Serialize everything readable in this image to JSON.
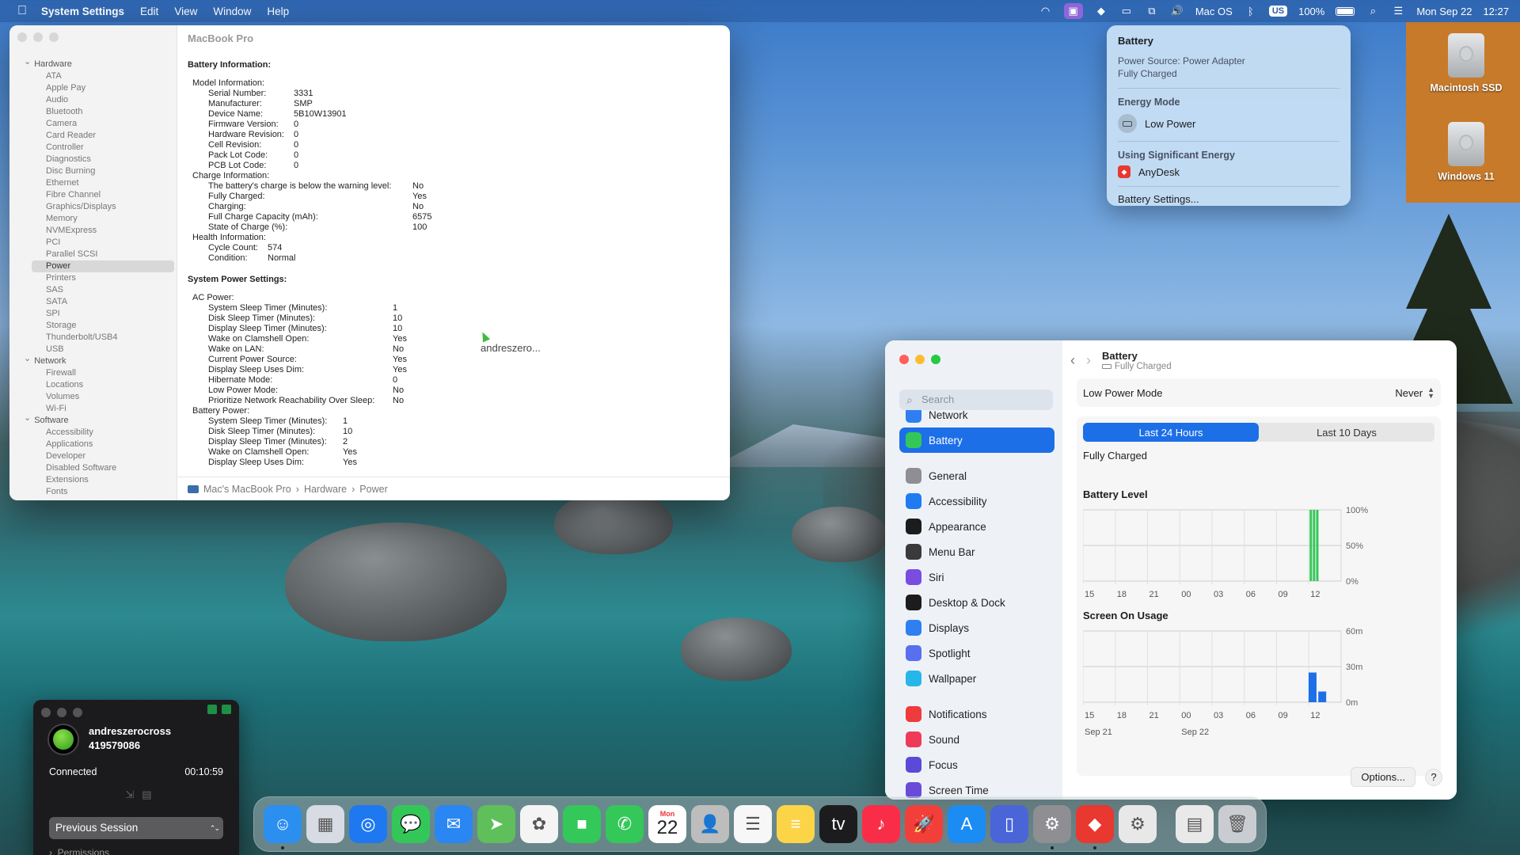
{
  "menubar": {
    "app_name": "System Settings",
    "menus": [
      "Edit",
      "View",
      "Window",
      "Help"
    ],
    "keyboard_layout": "Mac OS",
    "input_badge": "US",
    "battery_percent": "100%",
    "date": "Mon Sep 22",
    "time": "12:27",
    "icons": [
      "wifi-icon",
      "screen-share-icon",
      "anydesk-icon",
      "display-icon",
      "screen-mirroring-icon",
      "volume-icon",
      "bluetooth-icon",
      "battery-icon",
      "spotlight-icon",
      "control-center-icon"
    ]
  },
  "battery_menu": {
    "title": "Battery",
    "power_source": "Power Source: Power Adapter",
    "state": "Fully Charged",
    "energy_mode_title": "Energy Mode",
    "low_power": "Low Power",
    "significant_title": "Using Significant Energy",
    "app": "AnyDesk",
    "settings_link": "Battery Settings..."
  },
  "desktop_icons": [
    {
      "label": "Macintosh SSD"
    },
    {
      "label": "Windows 11"
    }
  ],
  "system_info": {
    "title": "MacBook Pro",
    "tree": [
      {
        "group": "Hardware",
        "items": [
          "ATA",
          "Apple Pay",
          "Audio",
          "Bluetooth",
          "Camera",
          "Card Reader",
          "Controller",
          "Diagnostics",
          "Disc Burning",
          "Ethernet",
          "Fibre Channel",
          "Graphics/Displays",
          "Memory",
          "NVMExpress",
          "PCI",
          "Parallel SCSI",
          "Power",
          "Printers",
          "SAS",
          "SATA",
          "SPI",
          "Storage",
          "Thunderbolt/USB4",
          "USB"
        ]
      },
      {
        "group": "Network",
        "items": [
          "Firewall",
          "Locations",
          "Volumes",
          "Wi-Fi"
        ]
      },
      {
        "group": "Software",
        "items": [
          "Accessibility",
          "Applications",
          "Developer",
          "Disabled Software",
          "Extensions",
          "Fonts"
        ]
      }
    ],
    "selected": "Power",
    "battery_info_heading": "Battery Information:",
    "model_info_heading": "Model Information:",
    "model_info": [
      [
        "Serial Number:",
        "3331"
      ],
      [
        "Manufacturer:",
        "SMP"
      ],
      [
        "Device Name:",
        "5B10W13901"
      ],
      [
        "Firmware Version:",
        "0"
      ],
      [
        "Hardware Revision:",
        "0"
      ],
      [
        "Cell Revision:",
        "0"
      ],
      [
        "Pack Lot Code:",
        "0"
      ],
      [
        "PCB Lot Code:",
        "0"
      ]
    ],
    "charge_info_heading": "Charge Information:",
    "charge_info": [
      [
        "The battery's charge is below the warning level:",
        "No"
      ],
      [
        "Fully Charged:",
        "Yes"
      ],
      [
        "Charging:",
        "No"
      ],
      [
        "Full Charge Capacity (mAh):",
        "6575"
      ],
      [
        "State of Charge (%):",
        "100"
      ]
    ],
    "health_info_heading": "Health Information:",
    "health_info": [
      [
        "Cycle Count:",
        "574"
      ],
      [
        "Condition:",
        "Normal"
      ]
    ],
    "power_settings_heading": "System Power Settings:",
    "ac_power_heading": "AC Power:",
    "ac_power": [
      [
        "System Sleep Timer (Minutes):",
        "1"
      ],
      [
        "Disk Sleep Timer (Minutes):",
        "10"
      ],
      [
        "Display Sleep Timer (Minutes):",
        "10"
      ],
      [
        "Wake on Clamshell Open:",
        "Yes"
      ],
      [
        "Wake on LAN:",
        "No"
      ],
      [
        "Current Power Source:",
        "Yes"
      ],
      [
        "Display Sleep Uses Dim:",
        "Yes"
      ],
      [
        "Hibernate Mode:",
        "0"
      ],
      [
        "Low Power Mode:",
        "No"
      ],
      [
        "Prioritize Network Reachability Over Sleep:",
        "No"
      ]
    ],
    "battery_power_heading": "Battery Power:",
    "battery_power": [
      [
        "System Sleep Timer (Minutes):",
        "1"
      ],
      [
        "Disk Sleep Timer (Minutes):",
        "10"
      ],
      [
        "Display Sleep Timer (Minutes):",
        "2"
      ],
      [
        "Wake on Clamshell Open:",
        "Yes"
      ],
      [
        "Display Sleep Uses Dim:",
        "Yes"
      ]
    ],
    "cursor_label": "andreszero...",
    "breadcrumb": [
      "Mac's MacBook Pro",
      "Hardware",
      "Power"
    ]
  },
  "settings": {
    "search_placeholder": "Search",
    "sidebar": [
      {
        "label": "Network",
        "color": "#2f7ff0",
        "icon": "globe-icon"
      },
      {
        "label": "Battery",
        "color": "#33c759",
        "icon": "battery-icon",
        "selected": true
      },
      {
        "gap": true
      },
      {
        "label": "General",
        "color": "#8e8e93",
        "icon": "gear-icon"
      },
      {
        "label": "Accessibility",
        "color": "#1f7bf2",
        "icon": "accessibility-icon"
      },
      {
        "label": "Appearance",
        "color": "#1c1c1e",
        "icon": "appearance-icon"
      },
      {
        "label": "Menu Bar",
        "color": "#3a3a3c",
        "icon": "menubar-icon"
      },
      {
        "label": "Siri",
        "color": "#7a4de0",
        "icon": "siri-icon"
      },
      {
        "label": "Desktop & Dock",
        "color": "#1c1c1e",
        "icon": "dock-icon"
      },
      {
        "label": "Displays",
        "color": "#2f7ff0",
        "icon": "displays-icon"
      },
      {
        "label": "Spotlight",
        "color": "#5a6ef0",
        "icon": "spotlight-icon"
      },
      {
        "label": "Wallpaper",
        "color": "#27b6e9",
        "icon": "wallpaper-icon"
      },
      {
        "gap": true
      },
      {
        "label": "Notifications",
        "color": "#ef3b3b",
        "icon": "notifications-icon"
      },
      {
        "label": "Sound",
        "color": "#ef3b5a",
        "icon": "sound-icon"
      },
      {
        "label": "Focus",
        "color": "#5b4ad8",
        "icon": "focus-icon"
      },
      {
        "label": "Screen Time",
        "color": "#6a4bd8",
        "icon": "screentime-icon"
      }
    ],
    "header_title": "Battery",
    "header_sub": "Fully Charged",
    "low_power_label": "Low Power Mode",
    "low_power_value": "Never",
    "tabs": [
      "Last 24 Hours",
      "Last 10 Days"
    ],
    "active_tab": 0,
    "status": "Fully Charged",
    "options_button": "Options...",
    "help_button": "?"
  },
  "chart_data": [
    {
      "type": "bar",
      "title": "Battery Level",
      "x_ticks": [
        "15",
        "18",
        "21",
        "00",
        "03",
        "06",
        "09",
        "12"
      ],
      "y_ticks": [
        "100%",
        "50%",
        "0%"
      ],
      "ylim": [
        0,
        100
      ],
      "bars": [
        {
          "hour_offset": 21.3,
          "value": 100
        },
        {
          "hour_offset": 21.6,
          "value": 100
        },
        {
          "hour_offset": 21.9,
          "value": 100
        }
      ],
      "color": "#34c759",
      "grid": true
    },
    {
      "type": "bar",
      "title": "Screen On Usage",
      "x_ticks": [
        "15",
        "18",
        "21",
        "00",
        "03",
        "06",
        "09",
        "12"
      ],
      "x_dates": [
        "Sep 21",
        "Sep 22"
      ],
      "y_ticks": [
        "60m",
        "30m",
        "0m"
      ],
      "ylim": [
        0,
        60
      ],
      "bars": [
        {
          "hour_offset": 21.2,
          "value": 25
        },
        {
          "hour_offset": 22.1,
          "value": 9
        }
      ],
      "color": "#1d6fe8",
      "grid": true
    }
  ],
  "anydesk": {
    "user": "andreszerocross",
    "id": "419579086",
    "status": "Connected",
    "duration": "00:10:59",
    "previous_session": "Previous Session",
    "permissions": "Permissions"
  },
  "dock": [
    {
      "name": "finder-icon",
      "color": "#2b8ff0",
      "glyph": "☺",
      "running": true
    },
    {
      "name": "launchpad-icon",
      "color": "#d7dbe3",
      "glyph": "▦"
    },
    {
      "name": "safari-icon",
      "color": "#1e78f0",
      "glyph": "◎"
    },
    {
      "name": "messages-icon",
      "color": "#33c759",
      "glyph": "💬"
    },
    {
      "name": "mail-icon",
      "color": "#2a86f2",
      "glyph": "✉"
    },
    {
      "name": "maps-icon",
      "color": "#5fbf5a",
      "glyph": "➤"
    },
    {
      "name": "photos-icon",
      "color": "#f4f4f4",
      "glyph": "✿"
    },
    {
      "name": "facetime-icon",
      "color": "#34c759",
      "glyph": "■"
    },
    {
      "name": "phone-icon",
      "color": "#34c759",
      "glyph": "✆"
    },
    {
      "name": "calendar-icon",
      "calendar": true,
      "month": "Mon",
      "day": "22"
    },
    {
      "name": "contacts-icon",
      "color": "#bdbdbd",
      "glyph": "👤"
    },
    {
      "name": "reminders-icon",
      "color": "#f7f7f7",
      "glyph": "☰"
    },
    {
      "name": "notes-icon",
      "color": "#fbd448",
      "glyph": "≡"
    },
    {
      "name": "tv-icon",
      "color": "#1c1c1e",
      "glyph": "tv"
    },
    {
      "name": "music-icon",
      "color": "#fa2d48",
      "glyph": "♪"
    },
    {
      "name": "rocket-icon",
      "color": "#f23f3a",
      "glyph": "🚀"
    },
    {
      "name": "app-store-icon",
      "color": "#1a8cf3",
      "glyph": "A"
    },
    {
      "name": "iphone-mirroring-icon",
      "color": "#4a65d8",
      "glyph": "▯"
    },
    {
      "name": "system-settings-icon",
      "color": "#8e8e93",
      "glyph": "⚙",
      "running": true
    },
    {
      "name": "anydesk-icon",
      "color": "#e8382f",
      "glyph": "◆",
      "running": true
    },
    {
      "name": "automator-icon",
      "color": "#e8e8e8",
      "glyph": "⚙"
    },
    {
      "sep": true
    },
    {
      "name": "document-stack-icon",
      "color": "#e9e9e9",
      "glyph": "▤"
    },
    {
      "name": "trash-icon",
      "color": "#c9cdd2",
      "glyph": "🗑"
    }
  ]
}
